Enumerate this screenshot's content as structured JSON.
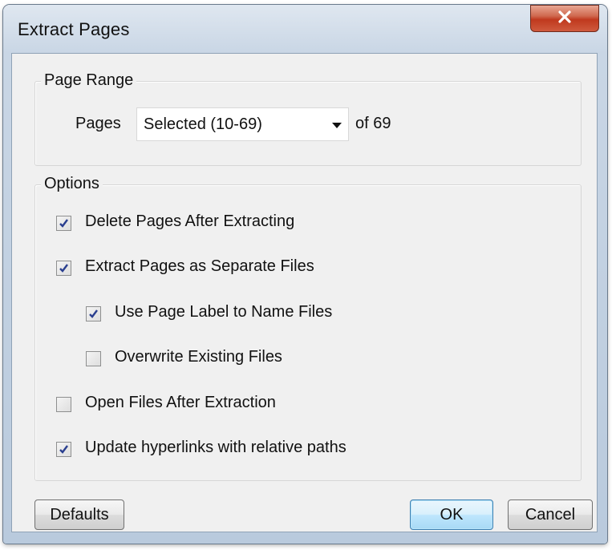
{
  "window": {
    "title": "Extract Pages",
    "close_label": "close"
  },
  "page_range": {
    "group_label": "Page Range",
    "pages_label": "Pages",
    "pages_value": "Selected (10-69)",
    "of_label": "of 69"
  },
  "options": {
    "group_label": "Options",
    "items": [
      {
        "label": "Delete Pages After Extracting",
        "checked": true
      },
      {
        "label": "Extract Pages as Separate Files",
        "checked": true
      },
      {
        "label": "Use Page Label to Name Files",
        "checked": true
      },
      {
        "label": "Overwrite Existing Files",
        "checked": false
      },
      {
        "label": "Open Files After Extraction",
        "checked": false
      },
      {
        "label": "Update hyperlinks with relative paths",
        "checked": true
      }
    ]
  },
  "buttons": {
    "defaults": "Defaults",
    "ok": "OK",
    "cancel": "Cancel"
  },
  "colors": {
    "accent": "#3c7fb1",
    "close": "#c0391e",
    "checkmark": "#2a3f8f"
  }
}
